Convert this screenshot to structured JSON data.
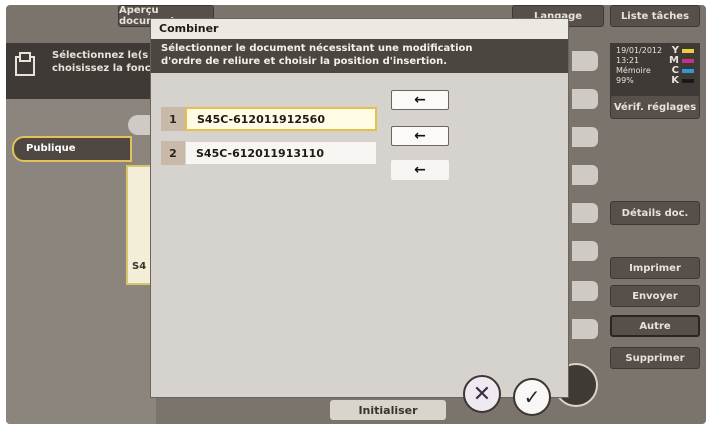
{
  "background": {
    "preview_tab": "Aperçu document",
    "language_button": "Langage",
    "job_list_button": "Liste tâches",
    "message_line1": "Sélectionnez le(s",
    "message_line2": "choisissez la fonc",
    "tab_publique": "Publique",
    "folder_label": "S4",
    "status": {
      "date": "19/01/2012",
      "time": "13:21",
      "memory_label": "Mémoire",
      "memory_value": "99%",
      "toner_levels": [
        "Y",
        "M",
        "C",
        "K"
      ],
      "toner_colors": [
        "#e8d23a",
        "#c8318a",
        "#2e9ad0",
        "#1a1a1a"
      ]
    },
    "verif_reglages": "Vérif. réglages",
    "details_doc": "Détails doc.",
    "imprimer": "Imprimer",
    "envoyer": "Envoyer",
    "autre": "Autre",
    "supprimer": "Supprimer",
    "initialiser": "Initialiser"
  },
  "dialog": {
    "title": "Combiner",
    "instruction_line1": "Sélectionner le document nécessitant une modification",
    "instruction_line2": "d'ordre de reliure et choisir la position d'insertion.",
    "documents": [
      {
        "number": "1",
        "name": "S45C-612011912560"
      },
      {
        "number": "2",
        "name": "S45C-612011913110"
      }
    ],
    "arrow_glyph": "←",
    "cancel_glyph": "✕",
    "ok_glyph": "✓"
  },
  "colors": {
    "selection_border": "#e4c04c",
    "dialog_background": "#d6d3cf"
  }
}
